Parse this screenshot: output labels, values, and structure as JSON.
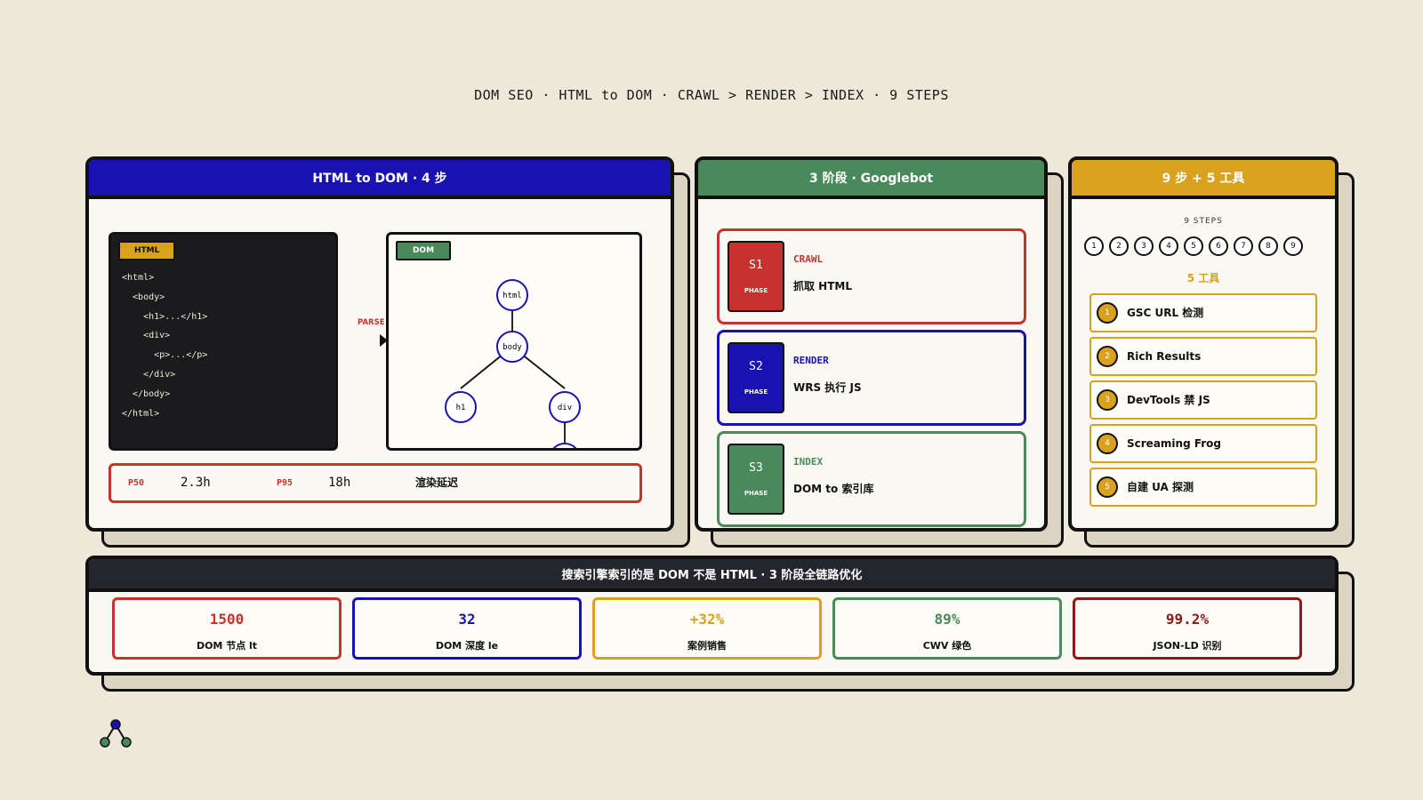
{
  "page_title": "DOM SEO · HTML to DOM · CRAWL > RENDER > INDEX · 9 STEPS",
  "colors": {
    "background": "#ece8da",
    "blue": "#1a12b0",
    "green": "#4a8a5a",
    "gold": "#d8a11e",
    "red": "#c8322e",
    "dark": "#25262b",
    "maroon": "#8c1a1a"
  },
  "html_dom": {
    "header": "HTML to DOM · 4 步",
    "html_tag": "HTML",
    "code_lines": [
      "<html>",
      "  <body>",
      "    <h1>...</h1>",
      "    <div>",
      "      <p>...</p>",
      "    </div>",
      "  </body>",
      "</html>"
    ],
    "parse_label": "PARSE",
    "dom_tag": "DOM",
    "tree_nodes": [
      "html",
      "body",
      "h1",
      "div",
      "p"
    ],
    "latency": {
      "p50_label": "P50",
      "p50_value": "2.3h",
      "p95_label": "P95",
      "p95_value": "18h",
      "caption": "渲染延迟"
    }
  },
  "phases": {
    "header": "3 阶段 · Googlebot",
    "items": [
      {
        "code": "S1",
        "small": "PHASE",
        "name": "CRAWL",
        "desc": "抓取 HTML"
      },
      {
        "code": "S2",
        "small": "PHASE",
        "name": "RENDER",
        "desc": "WRS 执行 JS"
      },
      {
        "code": "S3",
        "small": "PHASE",
        "name": "INDEX",
        "desc": "DOM to 索引库"
      }
    ]
  },
  "tools": {
    "header": "9 步 + 5 工具",
    "steps_title": "9 STEPS",
    "steps": [
      "1",
      "2",
      "3",
      "4",
      "5",
      "6",
      "7",
      "8",
      "9"
    ],
    "tools_title": "5 工具",
    "items": [
      {
        "num": "1",
        "label": "GSC URL 检测"
      },
      {
        "num": "2",
        "label": "Rich Results"
      },
      {
        "num": "3",
        "label": "DevTools 禁 JS"
      },
      {
        "num": "4",
        "label": "Screaming Frog"
      },
      {
        "num": "5",
        "label": "自建 UA 探测"
      }
    ]
  },
  "summary": {
    "header": "搜索引擎索引的是 DOM 不是 HTML · 3 阶段全链路优化",
    "metrics": [
      {
        "value": "1500",
        "label": "DOM 节点 lt"
      },
      {
        "value": "32",
        "label": "DOM 深度 le"
      },
      {
        "value": "+32%",
        "label": "案例销售"
      },
      {
        "value": "89%",
        "label": "CWV 绿色"
      },
      {
        "value": "99.2%",
        "label": "JSON-LD 识别"
      }
    ]
  }
}
